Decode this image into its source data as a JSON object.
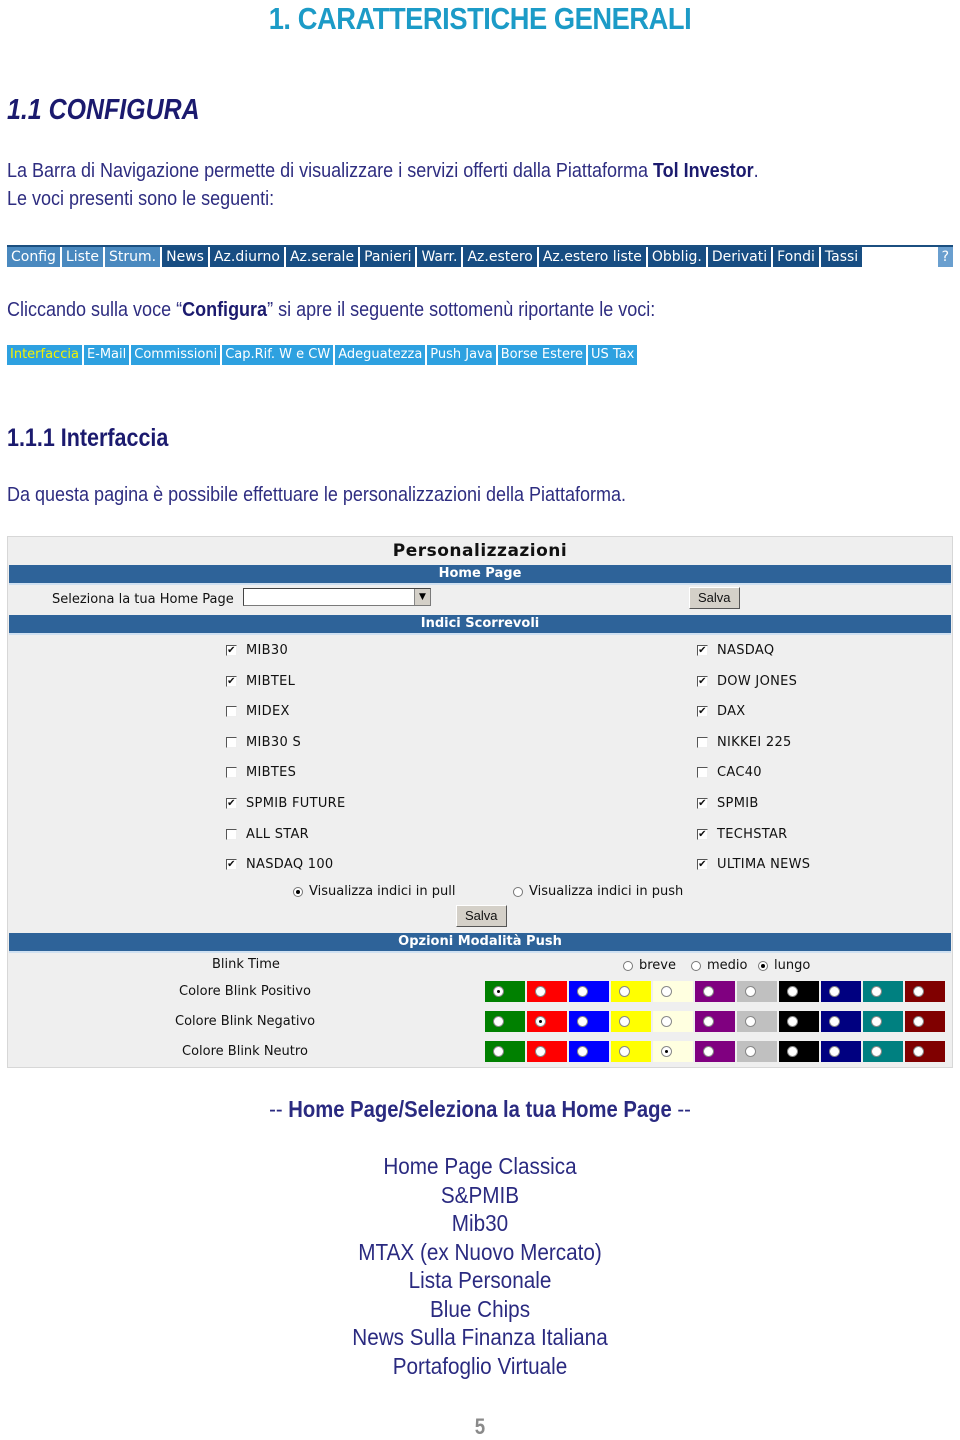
{
  "heading1": "1. CARATTERISTICHE GENERALI",
  "heading2": "1.1 CONFIGURA",
  "intro": {
    "line1_pre": "La Barra di Navigazione permette di visualizzare i servizi offerti dalla Piattaforma ",
    "line1_bold": "Tol Investor",
    "line1_post": ".",
    "line2": "Le voci presenti sono le seguenti:"
  },
  "navbar": {
    "items": [
      "Config",
      "Liste",
      "Strum.",
      "News",
      "Az.diurno",
      "Az.serale",
      "Panieri",
      "Warr.",
      "Az.estero",
      "Az.estero liste",
      "Obblig.",
      "Derivati",
      "Fondi",
      "Tassi",
      "?"
    ],
    "colors": {
      "dark": "#174d82",
      "light": "#4a89bf"
    }
  },
  "submenu_intro": {
    "pre": "Cliccando sulla voce “",
    "bold": "Configura",
    "post": "” si apre il seguente sottomenù riportante le voci:"
  },
  "submenu": {
    "items": [
      "Interfaccia",
      "E-Mail",
      "Commissioni",
      "Cap.Rif.  W e CW",
      "Adeguatezza",
      "Push Java",
      "Borse Estere",
      "US Tax"
    ],
    "active": "Interfaccia",
    "colors": {
      "bg": "#2ea1e0",
      "active_text": "#f6f200"
    }
  },
  "heading3": "1.1.1 Interfaccia",
  "interfaccia_desc": "Da questa pagina è possibile effettuare le personalizzazioni della Piattaforma.",
  "panel": {
    "title": "Personalizzazioni",
    "home_page_band": "Home Page",
    "select_label": "Seleziona la tua Home Page",
    "select_value": "",
    "save_label": "Salva",
    "indici_band": "Indici Scorrevoli",
    "indici_left": [
      {
        "label": "MIB30",
        "checked": true
      },
      {
        "label": "MIBTEL",
        "checked": true
      },
      {
        "label": "MIDEX",
        "checked": false
      },
      {
        "label": "MIB30 S",
        "checked": false
      },
      {
        "label": "MIBTES",
        "checked": false
      },
      {
        "label": "SPMIB FUTURE",
        "checked": true
      },
      {
        "label": "ALL STAR",
        "checked": false
      },
      {
        "label": "NASDAQ 100",
        "checked": true
      }
    ],
    "indici_right": [
      {
        "label": "NASDAQ",
        "checked": true
      },
      {
        "label": "DOW JONES",
        "checked": true
      },
      {
        "label": "DAX",
        "checked": true
      },
      {
        "label": "NIKKEI 225",
        "checked": false
      },
      {
        "label": "CAC40",
        "checked": false
      },
      {
        "label": "SPMIB",
        "checked": true
      },
      {
        "label": "TECHSTAR",
        "checked": true
      },
      {
        "label": "ULTIMA NEWS",
        "checked": true
      }
    ],
    "mode_pull": {
      "label": "Visualizza indici in pull",
      "selected": true
    },
    "mode_push": {
      "label": "Visualizza indici in push",
      "selected": false
    },
    "save2_label": "Salva",
    "push_band": "Opzioni Modalità Push",
    "blink_time_label": "Blink Time",
    "blink_time_options": [
      {
        "label": "breve",
        "selected": false
      },
      {
        "label": "medio",
        "selected": false
      },
      {
        "label": "lungo",
        "selected": true
      }
    ],
    "color_rows": [
      {
        "label": "Colore Blink Positivo",
        "selected_index": 0
      },
      {
        "label": "Colore Blink Negativo",
        "selected_index": 1
      },
      {
        "label": "Colore Blink Neutro",
        "selected_index": 4
      }
    ],
    "palette": [
      "#008000",
      "#ff0000",
      "#0000ff",
      "#ffff00",
      "#ffffe0",
      "#800080",
      "#c0c0c0",
      "#000000",
      "#000080",
      "#008080",
      "#800000"
    ]
  },
  "homepage_list": {
    "title_dash_pre": "-- ",
    "title": "Home Page/Seleziona la tua Home Page",
    "title_dash_post": " --",
    "items": [
      "Home Page Classica",
      "S&PMIB",
      "Mib30",
      "MTAX (ex Nuovo Mercato)",
      "Lista Personale",
      "Blue Chips",
      "News Sulla Finanza Italiana",
      "Portafoglio Virtuale"
    ]
  },
  "page_number": "5"
}
